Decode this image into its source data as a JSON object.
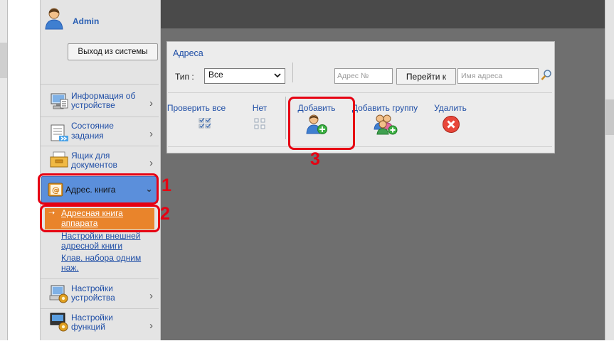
{
  "header": {
    "user_name": "Admin",
    "logout_label": "Выход из системы"
  },
  "sidebar": {
    "items": [
      {
        "label_line1": "Информация об",
        "label_line2": "устройстве",
        "icon": "device-info-icon"
      },
      {
        "label_line1": "Состояние",
        "label_line2": "задания",
        "icon": "job-status-icon"
      },
      {
        "label_line1": "Ящик для",
        "label_line2": "документов",
        "icon": "document-box-icon"
      },
      {
        "label_line1": "Адрес. книга",
        "icon": "address-book-icon"
      },
      {
        "label_line1": "Настройки",
        "label_line2": "устройства",
        "icon": "device-settings-icon"
      },
      {
        "label_line1": "Настройки",
        "label_line2": "функций",
        "icon": "function-settings-icon"
      }
    ],
    "sub_items": [
      {
        "label_line1": "Адресная книга",
        "label_line2": "аппарата"
      },
      {
        "label_line1": "Настройки внешней",
        "label_line2": "адресной книги"
      },
      {
        "label_line1": "Клав. набора одним",
        "label_line2": "наж."
      }
    ]
  },
  "panel": {
    "title": "Адреса",
    "type_label": "Тип :",
    "type_value": "Все",
    "address_no_placeholder": "Адрес №",
    "goto_label": "Перейти к",
    "name_placeholder": "Имя адреса",
    "tools": {
      "check_all": "Проверить все",
      "none": "Нет",
      "add": "Добавить",
      "add_group": "Добавить группу",
      "delete": "Удалить"
    }
  },
  "callouts": {
    "n1": "1",
    "n2": "2",
    "n3": "3"
  },
  "colors": {
    "accent_red": "#e60012",
    "selected_orange": "#e9842b",
    "active_blue": "#5b8fdb",
    "link_blue": "#1f4ea6"
  }
}
